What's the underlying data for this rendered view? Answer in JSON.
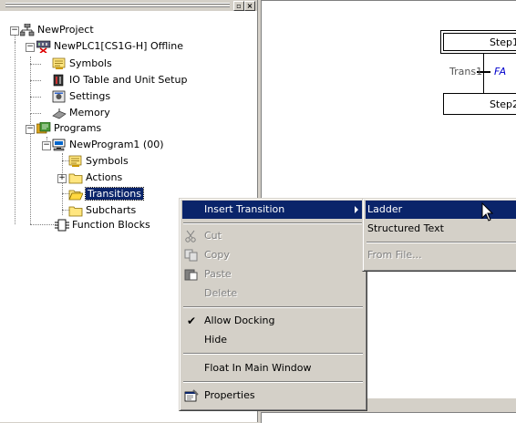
{
  "tree": {
    "project": "NewProject",
    "plc": "NewPLC1[CS1G-H] Offline",
    "symbols": "Symbols",
    "io_table": "IO Table and Unit Setup",
    "settings": "Settings",
    "memory": "Memory",
    "programs": "Programs",
    "program1": "NewProgram1 (00)",
    "prog_symbols": "Symbols",
    "actions": "Actions",
    "transitions": "Transitions",
    "subcharts": "Subcharts",
    "function_blocks": "Function Blocks"
  },
  "diagram": {
    "step1": "Step1",
    "trans1": "Trans1",
    "trans1_cond": "FA",
    "step2": "Step2"
  },
  "context_menu": {
    "insert_transition": "Insert Transition",
    "cut": "Cut",
    "copy": "Copy",
    "paste": "Paste",
    "delete": "Delete",
    "allow_docking": "Allow Docking",
    "hide": "Hide",
    "float_in_main_window": "Float In Main Window",
    "properties": "Properties"
  },
  "submenu": {
    "ladder": "Ladder",
    "structured_text": "Structured Text",
    "from_file": "From File..."
  },
  "colors": {
    "selection": "#0a246a",
    "face": "#d4d0c8",
    "disabled": "#808080",
    "condition_text": "#0000cc"
  }
}
